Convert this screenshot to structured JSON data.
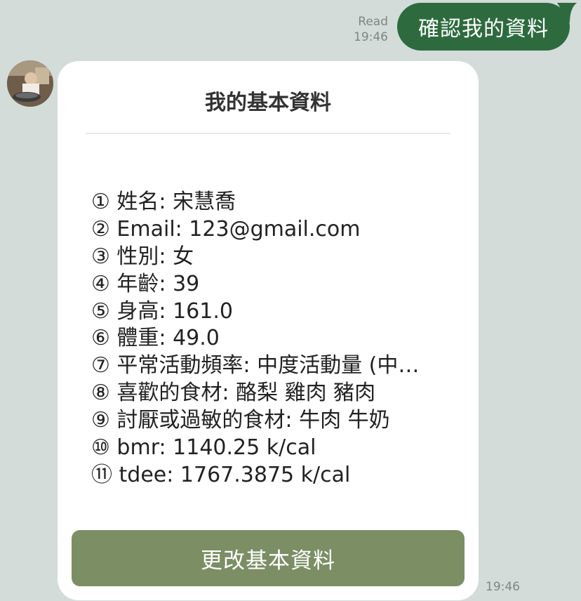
{
  "outgoing": {
    "status": "Read",
    "time": "19:46",
    "text": "確認我的資料"
  },
  "card": {
    "title": "我的基本資料",
    "items": [
      "① 姓名: 宋慧喬",
      "② Email:  123@gmail.com",
      "③ 性別: 女",
      "④ 年齡:  39",
      "⑤ 身高:  161.0",
      "⑥ 體重:  49.0",
      "⑦ 平常活動頻率: 中度活動量 (中…",
      "⑧ 喜歡的食材:  酪梨 雞肉 豬肉",
      "⑨ 討厭或過敏的食材:  牛肉 牛奶",
      "⑩ bmr:  1140.25  k/cal",
      "⑪ tdee:  1767.3875 k/cal"
    ],
    "button_label": "更改基本資料"
  },
  "incoming_time": "19:46",
  "colors": {
    "background": "#d3dcd9",
    "outgoing_bubble": "#2d6b3f",
    "button": "#7b8e64"
  }
}
